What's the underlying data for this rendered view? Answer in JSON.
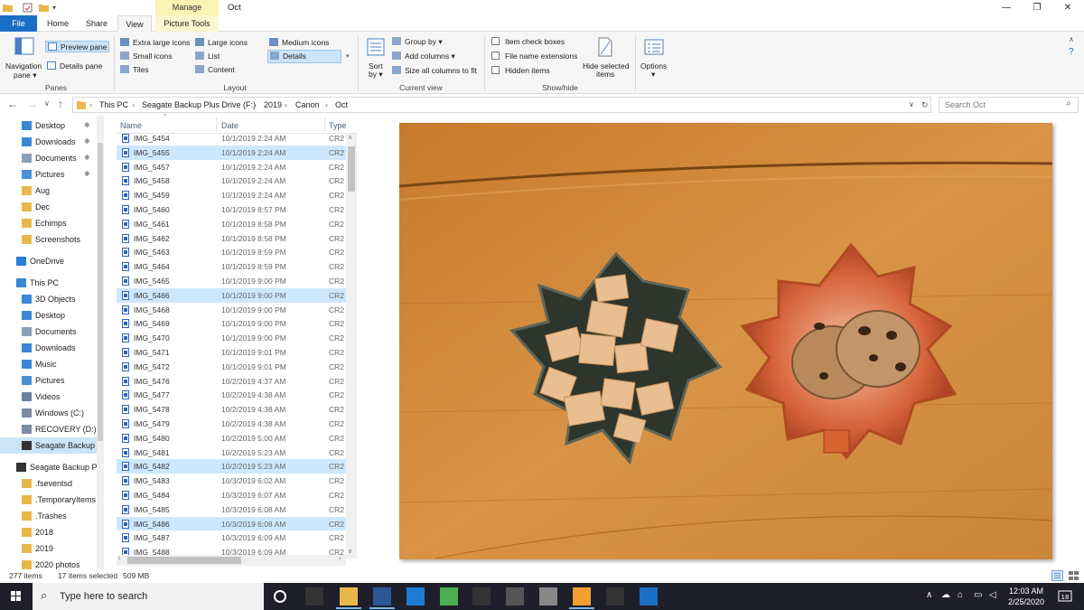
{
  "window": {
    "title": "Oct",
    "context_tab": "Manage",
    "controls": {
      "minimize": "—",
      "maximize": "❐",
      "close": "✕"
    }
  },
  "tabs": {
    "file": "File",
    "home": "Home",
    "share": "Share",
    "view": "View",
    "picture_tools": "Picture Tools"
  },
  "ribbon": {
    "panes": {
      "label": "Panes",
      "navigation_pane": "Navigation",
      "navigation_pane2": "pane ▾",
      "preview_pane": "Preview pane",
      "details_pane": "Details pane"
    },
    "layout": {
      "label": "Layout",
      "extra_large": "Extra large icons",
      "large": "Large icons",
      "medium": "Medium icons",
      "small": "Small icons",
      "list": "List",
      "details": "Details",
      "tiles": "Tiles",
      "content": "Content"
    },
    "current_view": {
      "label": "Current view",
      "sort_by": "Sort",
      "sort_by2": "by ▾",
      "group_by": "Group by ▾",
      "add_columns": "Add columns ▾",
      "size_all": "Size all columns to fit"
    },
    "show_hide": {
      "label": "Show/hide",
      "item_check_boxes": "Item check boxes",
      "file_name_extensions": "File name extensions",
      "hidden_items": "Hidden items",
      "hide_selected": "Hide selected",
      "hide_selected2": "items"
    },
    "options": {
      "label": "Options",
      "label2": "▾"
    }
  },
  "address": {
    "crumbs": [
      "This PC",
      "Seagate Backup Plus Drive (F:)",
      "2019",
      "Canon",
      "Oct"
    ],
    "search_placeholder": "Search Oct"
  },
  "nav": {
    "quick_access": [
      {
        "label": "Desktop",
        "pinned": true
      },
      {
        "label": "Downloads",
        "pinned": true
      },
      {
        "label": "Documents",
        "pinned": true
      },
      {
        "label": "Pictures",
        "pinned": true
      },
      {
        "label": "Aug"
      },
      {
        "label": "Dec"
      },
      {
        "label": "Echimps"
      },
      {
        "label": "Screenshots"
      }
    ],
    "onedrive": "OneDrive",
    "this_pc": "This PC",
    "pc_items": [
      "3D Objects",
      "Desktop",
      "Documents",
      "Downloads",
      "Music",
      "Pictures",
      "Videos",
      "Windows (C:)",
      "RECOVERY (D:)",
      "Seagate Backup"
    ],
    "drive": "Seagate Backup P",
    "drive_items": [
      ".fseventsd",
      ".TemporaryItems",
      ".Trashes",
      "2018",
      "2019",
      "2020 photos"
    ]
  },
  "filelist": {
    "columns": {
      "name": "Name",
      "date": "Date",
      "type": "Type"
    },
    "rows": [
      {
        "name": "IMG_5454",
        "date": "10/1/2019 2:24 AM",
        "type": "CR2 I",
        "selected": false
      },
      {
        "name": "IMG_5455",
        "date": "10/1/2019 2:24 AM",
        "type": "CR2 I",
        "selected": true
      },
      {
        "name": "IMG_5457",
        "date": "10/1/2019 2:24 AM",
        "type": "CR2 I",
        "selected": false
      },
      {
        "name": "IMG_5458",
        "date": "10/1/2019 2:24 AM",
        "type": "CR2 I",
        "selected": false
      },
      {
        "name": "IMG_5459",
        "date": "10/1/2019 2:24 AM",
        "type": "CR2 I",
        "selected": false
      },
      {
        "name": "IMG_5460",
        "date": "10/1/2019 8:57 PM",
        "type": "CR2 I",
        "selected": false
      },
      {
        "name": "IMG_5461",
        "date": "10/1/2019 8:58 PM",
        "type": "CR2 I",
        "selected": false
      },
      {
        "name": "IMG_5462",
        "date": "10/1/2019 8:58 PM",
        "type": "CR2 I",
        "selected": false
      },
      {
        "name": "IMG_5463",
        "date": "10/1/2019 8:59 PM",
        "type": "CR2 I",
        "selected": false
      },
      {
        "name": "IMG_5464",
        "date": "10/1/2019 8:59 PM",
        "type": "CR2 I",
        "selected": false
      },
      {
        "name": "IMG_5465",
        "date": "10/1/2019 9:00 PM",
        "type": "CR2 I",
        "selected": false
      },
      {
        "name": "IMG_5466",
        "date": "10/1/2019 9:00 PM",
        "type": "CR2 I",
        "selected": true
      },
      {
        "name": "IMG_5468",
        "date": "10/1/2019 9:00 PM",
        "type": "CR2 I",
        "selected": false
      },
      {
        "name": "IMG_5469",
        "date": "10/1/2019 9:00 PM",
        "type": "CR2 I",
        "selected": false
      },
      {
        "name": "IMG_5470",
        "date": "10/1/2019 9:00 PM",
        "type": "CR2 I",
        "selected": false
      },
      {
        "name": "IMG_5471",
        "date": "10/1/2019 9:01 PM",
        "type": "CR2 I",
        "selected": false
      },
      {
        "name": "IMG_5472",
        "date": "10/1/2019 9:01 PM",
        "type": "CR2 I",
        "selected": false
      },
      {
        "name": "IMG_5476",
        "date": "10/2/2019 4:37 AM",
        "type": "CR2 I",
        "selected": false
      },
      {
        "name": "IMG_5477",
        "date": "10/2/2019 4:38 AM",
        "type": "CR2 I",
        "selected": false
      },
      {
        "name": "IMG_5478",
        "date": "10/2/2019 4:38 AM",
        "type": "CR2 I",
        "selected": false
      },
      {
        "name": "IMG_5479",
        "date": "10/2/2019 4:38 AM",
        "type": "CR2 I",
        "selected": false
      },
      {
        "name": "IMG_5480",
        "date": "10/2/2019 5:00 AM",
        "type": "CR2 I",
        "selected": false
      },
      {
        "name": "IMG_5481",
        "date": "10/2/2019 5:23 AM",
        "type": "CR2 I",
        "selected": false
      },
      {
        "name": "IMG_5482",
        "date": "10/2/2019 5:23 AM",
        "type": "CR2 I",
        "selected": true
      },
      {
        "name": "IMG_5483",
        "date": "10/3/2019 6:02 AM",
        "type": "CR2 I",
        "selected": false
      },
      {
        "name": "IMG_5484",
        "date": "10/3/2019 6:07 AM",
        "type": "CR2 I",
        "selected": false
      },
      {
        "name": "IMG_5485",
        "date": "10/3/2019 6:08 AM",
        "type": "CR2 I",
        "selected": false
      },
      {
        "name": "IMG_5486",
        "date": "10/3/2019 6:08 AM",
        "type": "CR2 I",
        "selected": true
      },
      {
        "name": "IMG_5487",
        "date": "10/3/2019 6:09 AM",
        "type": "CR2 I",
        "selected": false
      },
      {
        "name": "IMG_5488",
        "date": "10/3/2019 6:09 AM",
        "type": "CR2 I",
        "selected": false
      }
    ]
  },
  "status": {
    "count": "277 items",
    "selected": "17 items selected",
    "size": "509 MB"
  },
  "taskbar": {
    "search_placeholder": "Type here to search",
    "time": "12:03 AM",
    "date": "2/25/2020",
    "apps": [
      "task-view-icon",
      "terminal-icon",
      "file-explorer-icon",
      "word-icon",
      "edge-icon",
      "chrome-icon",
      "money-icon",
      "screen-capture-icon",
      "photos-icon",
      "folder-app-icon",
      "grammar-icon",
      "mail-icon"
    ]
  },
  "colors": {
    "accent": "#1a6fc4",
    "selection": "#cce8ff",
    "taskbar": "#1f1f2b",
    "context_tab": "#fbf3b4"
  }
}
